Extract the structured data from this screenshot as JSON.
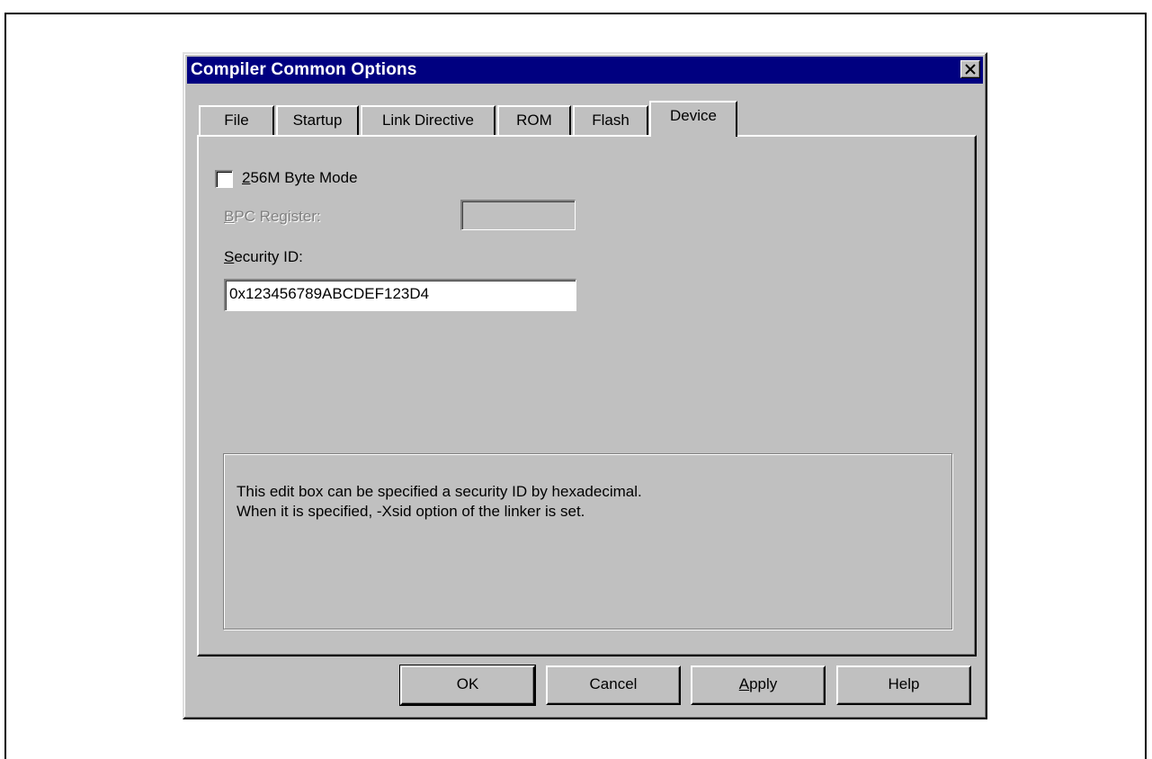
{
  "window": {
    "title": "Compiler Common Options"
  },
  "tabs": [
    {
      "label": "File"
    },
    {
      "label": "Startup"
    },
    {
      "label": "Link Directive"
    },
    {
      "label": "ROM"
    },
    {
      "label": "Flash"
    },
    {
      "label": "Device",
      "active": true
    }
  ],
  "device": {
    "byte_mode": {
      "label_mnemonic": "2",
      "label_rest": "56M Byte Mode",
      "checked": false
    },
    "bpc": {
      "label_mnemonic": "B",
      "label_rest": "PC Register:",
      "value": ""
    },
    "security": {
      "label_mnemonic": "S",
      "label_rest": "ecurity ID:",
      "value": "0x123456789ABCDEF123D4"
    }
  },
  "description": {
    "line1": "This edit box can be specified a security ID by hexadecimal.",
    "line2": "When it is specified, -Xsid option of the linker is set."
  },
  "buttons": {
    "ok": "OK",
    "cancel": "Cancel",
    "apply_mnemonic": "A",
    "apply_rest": "pply",
    "help": "Help"
  },
  "colors": {
    "titlebar": "#000080",
    "face": "#c0c0c0"
  }
}
